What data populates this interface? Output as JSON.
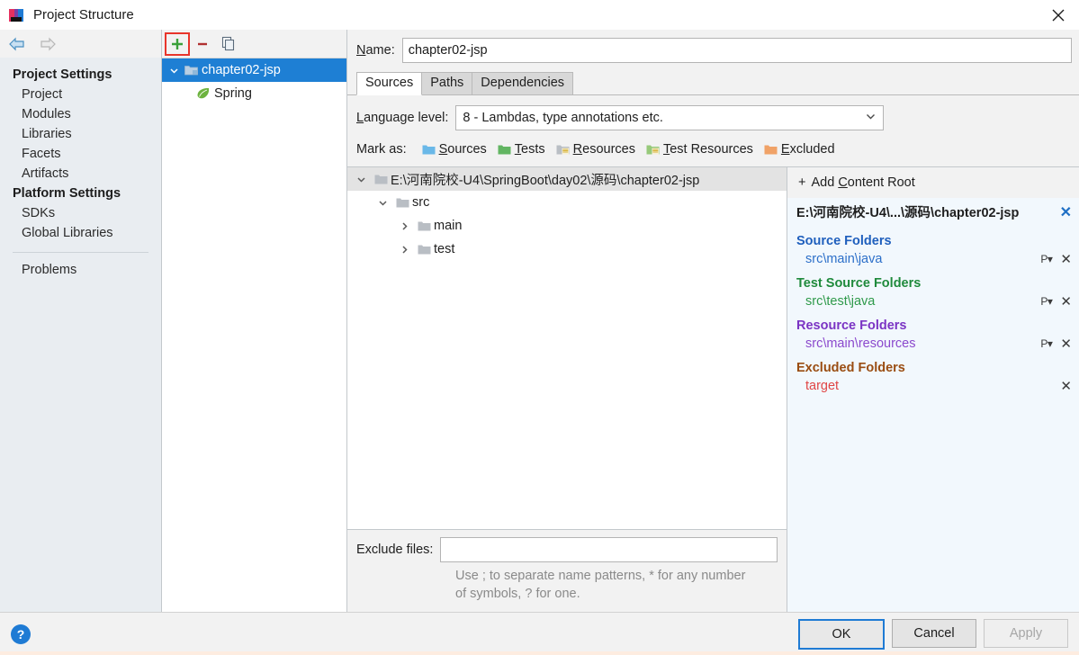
{
  "window": {
    "title": "Project Structure",
    "icon": "intellij-idea-icon",
    "close_label": "✕"
  },
  "nav": {
    "back_icon": "arrow-left-icon",
    "forward_icon": "arrow-right-icon"
  },
  "sidebar": {
    "groups": [
      {
        "title": "Project Settings",
        "items": [
          "Project",
          "Modules",
          "Libraries",
          "Facets",
          "Artifacts"
        ]
      },
      {
        "title": "Platform Settings",
        "items": [
          "SDKs",
          "Global Libraries"
        ]
      }
    ],
    "problems": "Problems"
  },
  "module_panel": {
    "toolbar": [
      {
        "name": "add-module-button",
        "glyph": "+",
        "highlighted": true
      },
      {
        "name": "remove-module-button",
        "glyph": "−",
        "highlighted": false
      },
      {
        "name": "copy-module-button",
        "glyph": "copy-icon",
        "highlighted": false
      }
    ],
    "tree": [
      {
        "label": "chapter02-jsp",
        "selected": true,
        "expanded": true,
        "icon": "module-icon"
      },
      {
        "label": "Spring",
        "selected": false,
        "child": true,
        "icon": "spring-leaf-icon"
      }
    ]
  },
  "main": {
    "name_label": "Name:",
    "name_value": "chapter02-jsp",
    "tabs": [
      {
        "label": "Sources",
        "active": true
      },
      {
        "label": "Paths",
        "active": false
      },
      {
        "label": "Dependencies",
        "active": false
      }
    ],
    "language_level_label": "Language level:",
    "language_level_value": "8 - Lambdas, type annotations etc.",
    "mark_as_label": "Mark as:",
    "mark_options": [
      {
        "label": "Sources",
        "mnemonic": "S",
        "rest": "ources",
        "color": "#6ab8e8"
      },
      {
        "label": "Tests",
        "mnemonic": "T",
        "rest": "ests",
        "color": "#62b562"
      },
      {
        "label": "Resources",
        "mnemonic": "R",
        "rest": "esources",
        "color": "#b9bec4"
      },
      {
        "label": "Test Resources",
        "mnemonic": "T",
        "rest": "est Resources",
        "color": "#97c97a"
      },
      {
        "label": "Excluded",
        "mnemonic": "E",
        "rest": "xcluded",
        "color": "#f0a267"
      }
    ],
    "content_tree": [
      {
        "label": "E:\\河南院校-U4\\SpringBoot\\day02\\源码\\chapter02-jsp",
        "indent": 0,
        "expanded": true,
        "root": true
      },
      {
        "label": "src",
        "indent": 1,
        "expanded": true,
        "root": false
      },
      {
        "label": "main",
        "indent": 2,
        "expanded": false,
        "root": false
      },
      {
        "label": "test",
        "indent": 2,
        "expanded": false,
        "root": false
      }
    ],
    "exclude_files_label": "Exclude files:",
    "exclude_files_value": "",
    "exclude_hint_line1": "Use ; to separate name patterns, * for any",
    "exclude_hint_line2": "number of symbols, ? for one."
  },
  "content_root": {
    "add_label": "+ Add Content Root",
    "add_mnemonic": "C",
    "root_path": "E:\\河南院校-U4\\...\\源码\\chapter02-jsp",
    "root_remove": "✕",
    "sections": [
      {
        "title": "Source Folders",
        "color": "#1f5fbd",
        "item_color": "#2c6fc9",
        "items": [
          {
            "path": "src\\main\\java",
            "has_prefix": true,
            "prefix_glyph": "P",
            "remove": "✕"
          }
        ]
      },
      {
        "title": "Test Source Folders",
        "color": "#1f8a3c",
        "item_color": "#2f9a4b",
        "items": [
          {
            "path": "src\\test\\java",
            "has_prefix": true,
            "prefix_glyph": "P",
            "remove": "✕"
          }
        ]
      },
      {
        "title": "Resource Folders",
        "color": "#7b34c4",
        "item_color": "#8b49cd",
        "items": [
          {
            "path": "src\\main\\resources",
            "has_prefix": true,
            "prefix_glyph": "P",
            "remove": "✕"
          }
        ]
      },
      {
        "title": "Excluded Folders",
        "color": "#9a4d12",
        "item_color": "#e04545",
        "items": [
          {
            "path": "target",
            "has_prefix": false,
            "prefix_glyph": "",
            "remove": "✕"
          }
        ]
      }
    ]
  },
  "footer": {
    "help_glyph": "?",
    "ok": "OK",
    "cancel": "Cancel",
    "apply": "Apply"
  },
  "colors": {
    "selection_blue": "#1e7fd4",
    "highlight_red": "#e8352b",
    "panel_blue": "#f2f8fd"
  }
}
